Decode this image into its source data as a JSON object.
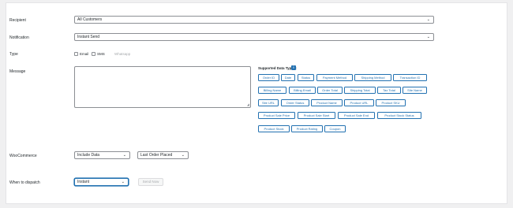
{
  "form": {
    "recipient": {
      "label": "Recipient",
      "value": "All Customers"
    },
    "notification": {
      "label": "Notification",
      "value": "Instant Send"
    },
    "type": {
      "label": "Type",
      "options": [
        {
          "label": "Email",
          "checked": false
        },
        {
          "label": "SMS",
          "checked": false
        },
        {
          "label": "Whatsapp",
          "checked": false,
          "disabled": true
        }
      ]
    },
    "message": {
      "label": "Message",
      "value": ""
    },
    "supported_types": {
      "title": "Supported Data Types:",
      "info": "i",
      "tags": [
        "Order ID",
        "Date",
        "Status",
        "Payment Method",
        "Shipping Method",
        "Transaction ID",
        "Billing Name",
        "Billing Email",
        "Order Total",
        "Shipping Total",
        "Tax Total",
        "Site Name",
        "Site URL",
        "Order Status",
        "Product Name",
        "Product URL",
        "Product SKU",
        "Product Sale Price",
        "Product Sale Start",
        "Product Sale End",
        "Product Stock Status",
        "Product Stock",
        "Product Rating",
        "Coupon"
      ]
    },
    "woocommerce": {
      "label": "WooCommerce",
      "include_value": "Include Data",
      "event_value": "Last Order Placed"
    },
    "dispatch": {
      "label": "When to dispatch",
      "value": "Instant",
      "send_now": "Send Now"
    }
  },
  "colors": {
    "accent": "#2271b1",
    "background": "#f0f0f1",
    "panel": "#ffffff"
  }
}
